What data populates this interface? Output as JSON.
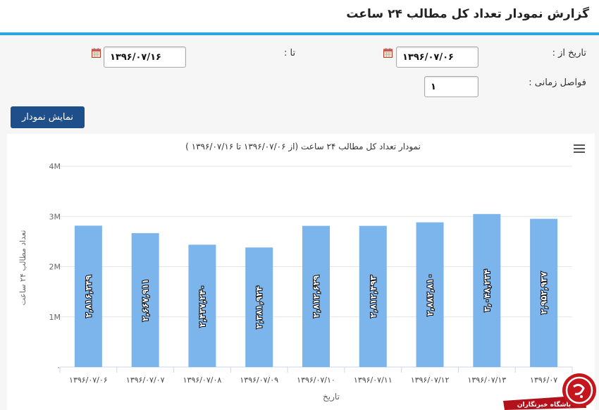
{
  "header": {
    "title": "گزارش نمودار تعداد کل مطالب ۲۴ ساعت"
  },
  "form": {
    "from_label": "تاریخ از :",
    "from_value": "۱۳۹۶/۰۷/۰۶",
    "to_label": "تا :",
    "to_value": "۱۳۹۶/۰۷/۱۶",
    "interval_label": "فواصل زمانی :",
    "interval_value": "۱",
    "submit_label": "نمایش نمودار"
  },
  "watermark": {
    "text": "باشگاه خبرنگاران"
  },
  "chart_data": {
    "type": "bar",
    "title": "نمودار تعداد کل مطالب ۲۴ ساعت (از ۱۳۹۶/۰۷/۰۶ تا ۱۳۹۶/۰۷/۱۶ )",
    "xlabel": "تاریخ",
    "ylabel": "تعداد مطالب ۲۴ ساعت",
    "categories": [
      "۱۳۹۶/۰۷/۰۶",
      "۱۳۹۶/۰۷/۰۷",
      "۱۳۹۶/۰۷/۰۸",
      "۱۳۹۶/۰۷/۰۹",
      "۱۳۹۶/۰۷/۱۰",
      "۱۳۹۶/۰۷/۱۱",
      "۱۳۹۶/۰۷/۱۲",
      "۱۳۹۶/۰۷/۱۳",
      "۱۳۹۶/۰۷/۱۴"
    ],
    "tick_labels": [
      "۱۳۹۶/۰۷/۰۶",
      "۱۳۹۶/۰۷/۰۷",
      "۱۳۹۶/۰۷/۰۸",
      "۱۳۹۶/۰۷/۰۹",
      "۱۳۹۶/۰۷/۱۰",
      "۱۳۹۶/۰۷/۱۱",
      "۱۳۹۶/۰۷/۱۲",
      "۱۳۹۶/۰۷/۱۳",
      "۱۳۹۶/۰۷"
    ],
    "values": [
      2816349,
      2667911,
      2437240,
      2381924,
      2812629,
      2812493,
      2882810,
      3048234,
      2952937
    ],
    "value_labels": [
      "۲,۸۱۶,۳۴۹",
      "۲,۶۶۷,۹۱۱",
      "۲,۴۳۷,۲۴۰",
      "۲,۳۸۱,۹۲۴",
      "۲,۸۱۲,۶۲۹",
      "۲,۸۱۲,۴۹۳",
      "۲,۸۸۲,۸۱۰",
      "۳,۰۴۸,۲۳۴",
      "۲,۹۵۲,۹۳۷"
    ],
    "ylim": [
      0,
      4000000
    ],
    "yticks": [
      0,
      1000000,
      2000000,
      3000000,
      4000000
    ],
    "ytick_labels": [
      "۰",
      "1M",
      "2M",
      "3M",
      "4M"
    ],
    "grid": true,
    "bar_color": "#7cb5ec"
  }
}
